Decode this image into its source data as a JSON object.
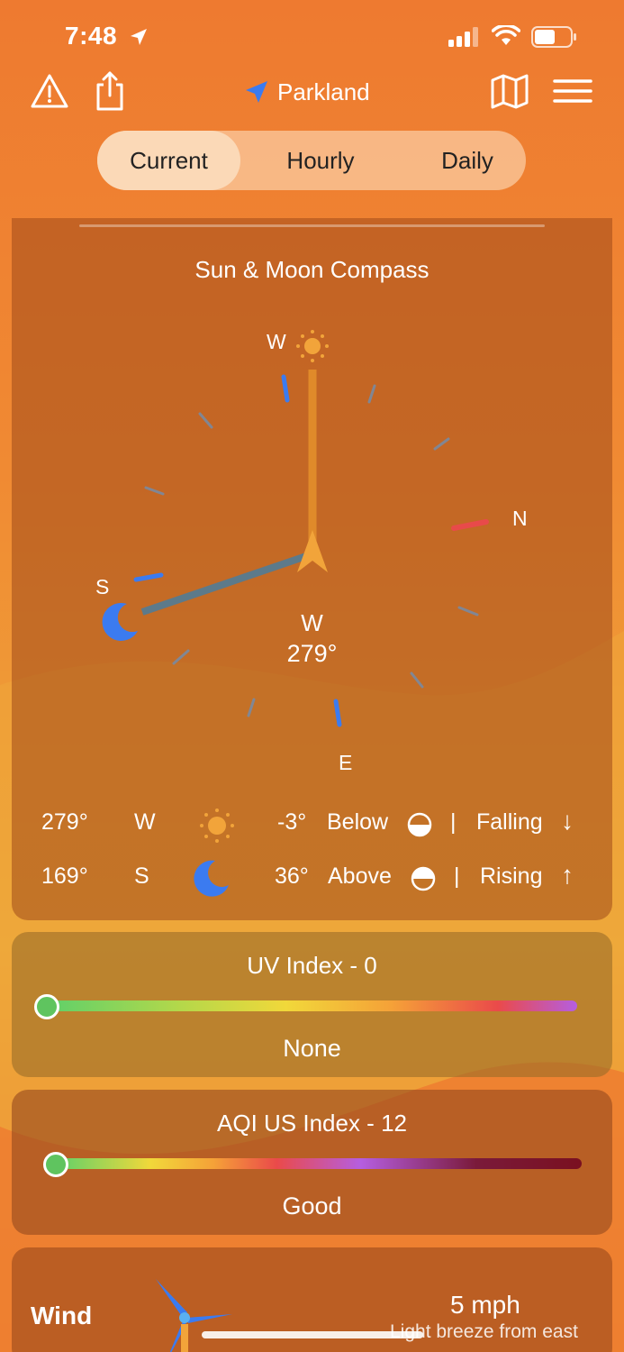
{
  "status": {
    "time": "7:48"
  },
  "toolbar": {
    "location": "Parkland",
    "icons": [
      "alert-icon",
      "share-icon",
      "location-arrow-icon",
      "map-icon",
      "menu-icon"
    ]
  },
  "tabs": [
    {
      "label": "Current",
      "active": true
    },
    {
      "label": "Hourly",
      "active": false
    },
    {
      "label": "Daily",
      "active": false
    }
  ],
  "compass": {
    "title": "Sun & Moon Compass",
    "labels": {
      "top": "W",
      "right": "N",
      "left": "S",
      "bottom": "E"
    },
    "heading_dir": "W",
    "heading_deg": "279°",
    "sun": {
      "azimuth": "279°",
      "dir": "W",
      "altitude": "-3°",
      "position": "Below",
      "sep": "|",
      "trend": "Falling",
      "trend_arrow": "↓"
    },
    "moon": {
      "azimuth": "169°",
      "dir": "S",
      "altitude": "36°",
      "position": "Above",
      "sep": "|",
      "trend": "Rising",
      "trend_arrow": "↑"
    },
    "colors": {
      "sun": "#f2a43a",
      "moon": "#3b7bf0",
      "north": "#e84a4a"
    }
  },
  "uv": {
    "title": "UV Index - 0",
    "label": "None",
    "value": 0
  },
  "aqi": {
    "title": "AQI US Index - 12",
    "label": "Good",
    "value": 12
  },
  "wind": {
    "title": "Wind",
    "speed": "5 mph",
    "description": "Light breeze from east"
  }
}
